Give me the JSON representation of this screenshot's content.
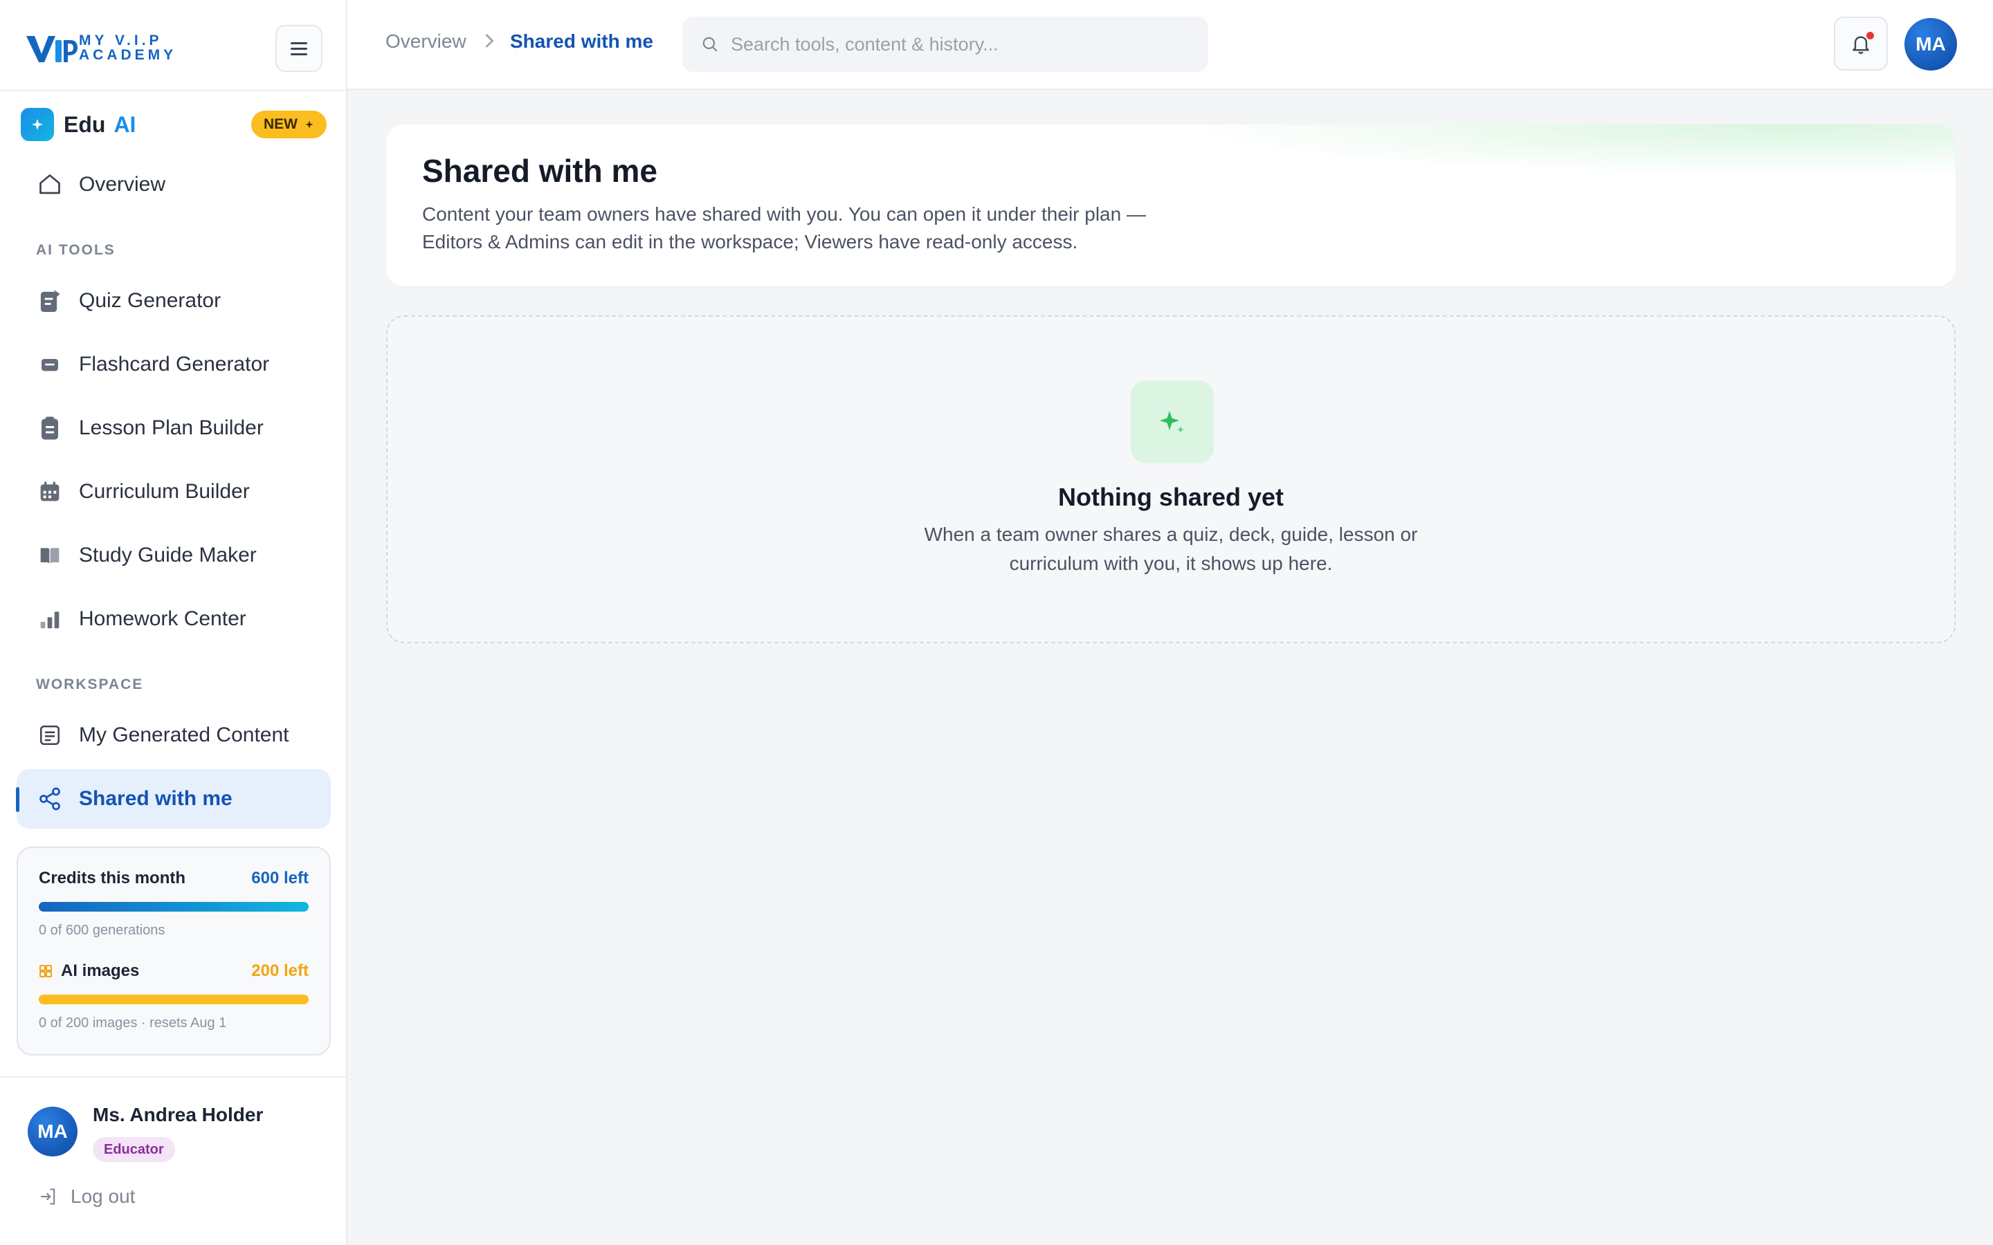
{
  "brand": {
    "name_line1": "MY V.I.P",
    "name_line2": "ACADEMY"
  },
  "eduai": {
    "name": "Edu",
    "ai": "AI",
    "badge": "NEW"
  },
  "nav": {
    "overview": "Overview",
    "section_ai_tools": "AI TOOLS",
    "tools": [
      {
        "label": "Quiz Generator",
        "icon": "quiz-icon"
      },
      {
        "label": "Flashcard Generator",
        "icon": "flashcard-icon"
      },
      {
        "label": "Lesson Plan Builder",
        "icon": "clipboard-icon"
      },
      {
        "label": "Curriculum Builder",
        "icon": "calendar-icon"
      },
      {
        "label": "Study Guide Maker",
        "icon": "book-icon"
      },
      {
        "label": "Homework Center",
        "icon": "bar-chart-icon"
      }
    ],
    "section_workspace": "WORKSPACE",
    "my_content": "My Generated Content",
    "shared": "Shared with me"
  },
  "credits": {
    "title": "Credits this month",
    "left": "600 left",
    "fill": 1.0,
    "sub": "0 of 600 generations",
    "images_title": "AI images",
    "images_left": "200 left",
    "images_fill": 1.0,
    "images_sub": "0 of 200 images · resets Aug 1"
  },
  "user": {
    "initials": "MA",
    "name": "Ms. Andrea Holder",
    "role": "Educator",
    "logout": "Log out"
  },
  "topbar": {
    "crumb_root": "Overview",
    "crumb_current": "Shared with me",
    "search_placeholder": "Search tools, content & history...",
    "avatar_initials": "MA"
  },
  "page": {
    "title": "Shared with me",
    "description": "Content your team owners have shared with you. You can open it under their plan — Editors & Admins can edit in the workspace; Viewers have read-only access."
  },
  "empty": {
    "title": "Nothing shared yet",
    "description": "When a team owner shares a quiz, deck, guide, lesson or curriculum with you, it shows up here."
  },
  "colors": {
    "accent": "#1565c0",
    "credits_bar": "#1a8fe8",
    "images_bar": "#fbbd1f",
    "badge": "#fbbd1f",
    "empty_icon": "#2fbf5b"
  }
}
